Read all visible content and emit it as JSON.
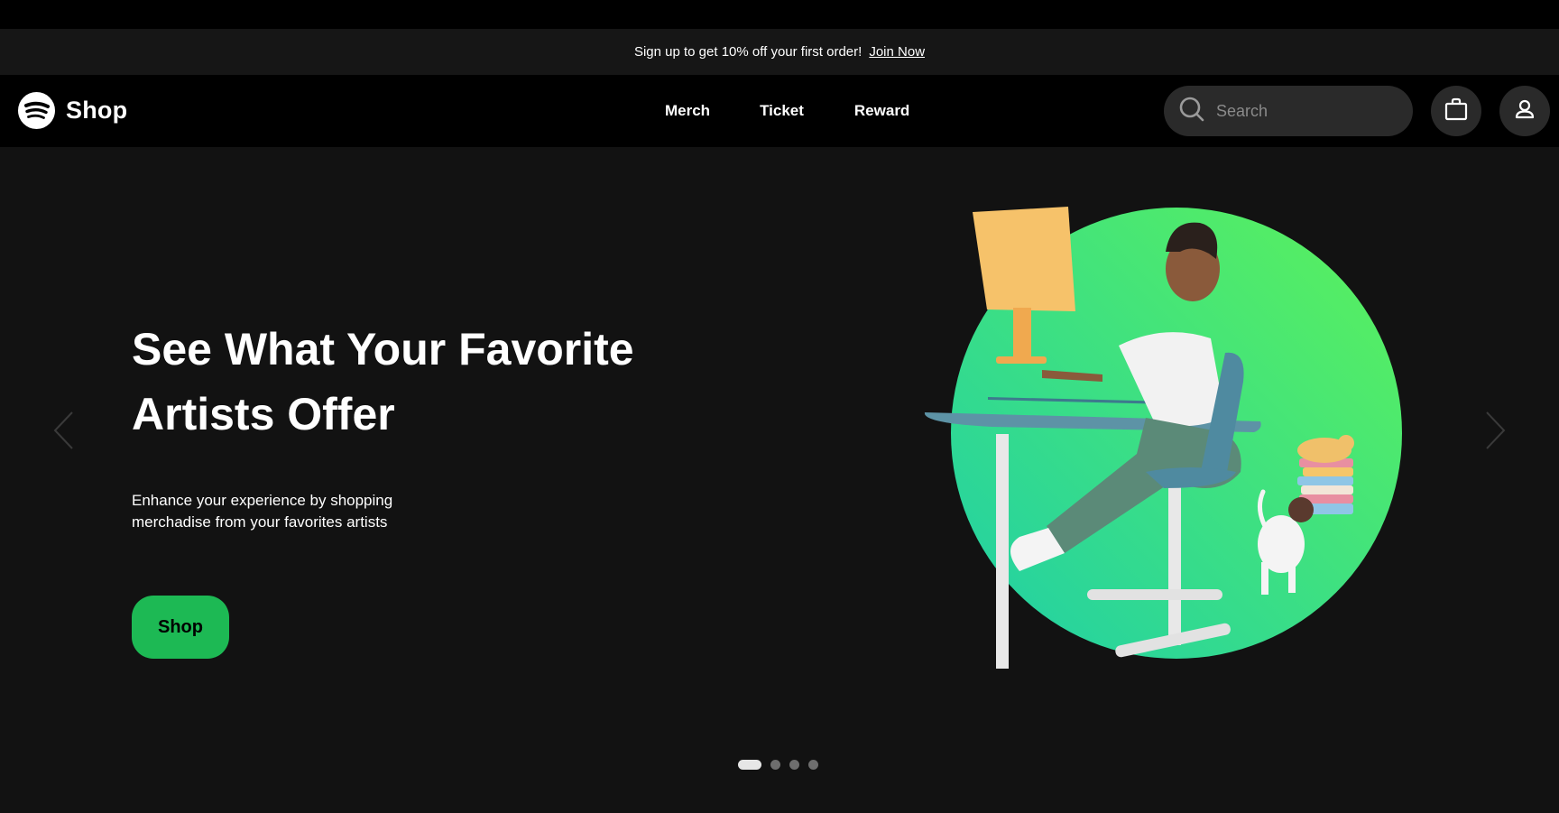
{
  "promo": {
    "text": "Sign up to get 10% off your first order!",
    "link": "Join Now"
  },
  "header": {
    "logo_text": "Shop",
    "nav": [
      "Merch",
      "Ticket",
      "Reward"
    ],
    "search_placeholder": "Search",
    "icons": [
      "search-icon",
      "shopping-bag-icon",
      "user-icon"
    ]
  },
  "hero": {
    "title_line1": "See What Your Favorite",
    "title_line2": "Artists Offer",
    "subtitle_line1": "Enhance your experience by shopping",
    "subtitle_line2": "merchadise from your favorites artists",
    "cta": "Shop",
    "slides": 4,
    "active_slide": 1
  },
  "colors": {
    "accent": "#1db954",
    "background": "#121212",
    "header": "#000000",
    "gradient_start": "#1fcfa8",
    "gradient_end": "#5df25a"
  }
}
